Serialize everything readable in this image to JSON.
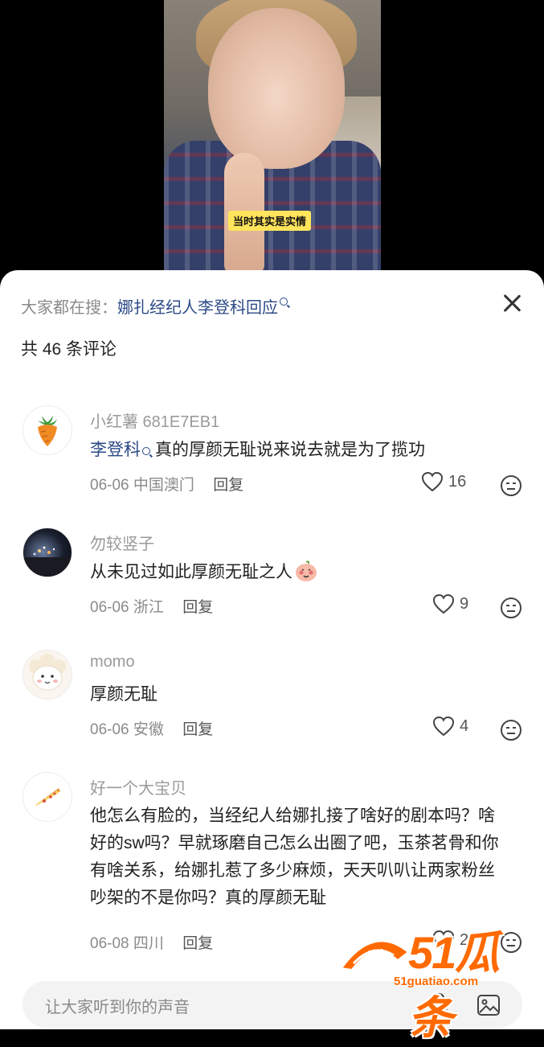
{
  "video": {
    "subtitle": "当时其实是实情"
  },
  "header": {
    "search_prefix": "大家都在搜：",
    "search_term": "娜扎经纪人李登科回应",
    "comment_count": "共 46 条评论"
  },
  "comments": [
    {
      "username": "小红薯 681E7EB1",
      "mention": "李登科",
      "text": "真的厚颜无耻说来说去就是为了揽功",
      "date": "06-06",
      "location": "中国澳门",
      "reply_label": "回复",
      "likes": "16",
      "avatar_icon": "carrot-icon"
    },
    {
      "username": "勿较竖子",
      "mention": "",
      "text": "从未见过如此厚颜无耻之人",
      "date": "06-06",
      "location": "浙江",
      "reply_label": "回复",
      "likes": "9",
      "avatar_icon": "night-city-avatar"
    },
    {
      "username": "momo",
      "mention": "",
      "text": "厚颜无耻",
      "date": "06-06",
      "location": "安徽",
      "reply_label": "回复",
      "likes": "4",
      "avatar_icon": "sheep-avatar"
    },
    {
      "username": "好一个大宝贝",
      "mention": "",
      "text": "他怎么有脸的，当经纪人给娜扎接了啥好的剧本吗？啥好的sw吗？早就琢磨自己怎么出圈了吧，玉茶茗骨和你有啥关系，给娜扎惹了多少麻烦，天天叭叭让两家粉丝吵架的不是你吗？真的厚颜无耻",
      "date": "06-08",
      "location": "四川",
      "reply_label": "回复",
      "likes": "2",
      "avatar_icon": "pizza-icon"
    }
  ],
  "input": {
    "placeholder": "让大家听到你的声音"
  },
  "watermark": {
    "logo": "51瓜条",
    "url": "51guatiao.com"
  },
  "colors": {
    "link": "#2c4a86",
    "watermark": "#ff6a00"
  }
}
